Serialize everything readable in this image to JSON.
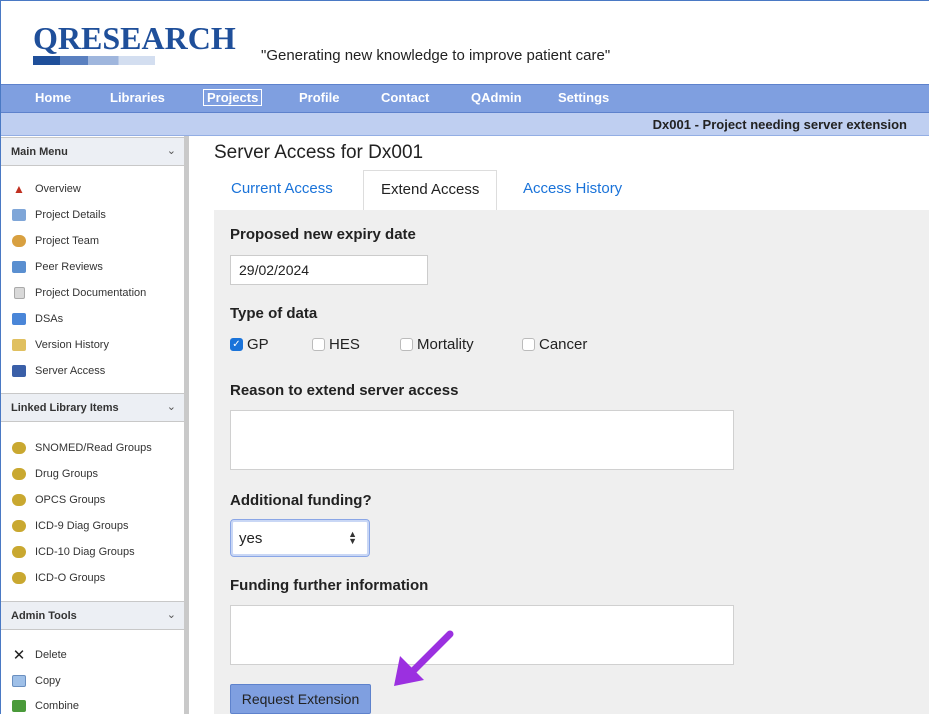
{
  "header": {
    "logo_text": "QRESEARCH",
    "tagline": "\"Generating new knowledge to improve patient care\""
  },
  "nav": {
    "items": [
      {
        "label": "Home",
        "active": false
      },
      {
        "label": "Libraries",
        "active": false
      },
      {
        "label": "Projects",
        "active": true
      },
      {
        "label": "Profile",
        "active": false
      },
      {
        "label": "Contact",
        "active": false
      },
      {
        "label": "QAdmin",
        "active": false
      },
      {
        "label": "Settings",
        "active": false
      }
    ]
  },
  "project": {
    "title": "Dx001 - Project needing server extension"
  },
  "sidebar": {
    "main_menu": {
      "heading": "Main Menu",
      "items": [
        {
          "label": "Overview",
          "icon": "overview-icon"
        },
        {
          "label": "Project Details",
          "icon": "project-details-icon"
        },
        {
          "label": "Project Team",
          "icon": "team-icon"
        },
        {
          "label": "Peer Reviews",
          "icon": "peer-review-icon"
        },
        {
          "label": "Project Documentation",
          "icon": "document-icon"
        },
        {
          "label": "DSAs",
          "icon": "dsa-icon"
        },
        {
          "label": "Version History",
          "icon": "version-history-icon"
        },
        {
          "label": "Server Access",
          "icon": "server-icon"
        }
      ]
    },
    "linked_library": {
      "heading": "Linked Library Items",
      "items": [
        {
          "label": "SNOMED/Read Groups",
          "icon": "library-group-icon"
        },
        {
          "label": "Drug Groups",
          "icon": "library-group-icon"
        },
        {
          "label": "OPCS Groups",
          "icon": "library-group-icon"
        },
        {
          "label": "ICD-9 Diag Groups",
          "icon": "library-group-icon"
        },
        {
          "label": "ICD-10 Diag Groups",
          "icon": "library-group-icon"
        },
        {
          "label": "ICD-O Groups",
          "icon": "library-group-icon"
        }
      ]
    },
    "admin_tools": {
      "heading": "Admin Tools",
      "items": [
        {
          "label": "Delete",
          "icon": "delete-x-icon"
        },
        {
          "label": "Copy",
          "icon": "copy-icon"
        },
        {
          "label": "Combine",
          "icon": "combine-icon"
        }
      ]
    }
  },
  "main": {
    "page_title": "Server Access for Dx001",
    "tabs": [
      {
        "label": "Current Access",
        "active": false
      },
      {
        "label": "Extend Access",
        "active": true
      },
      {
        "label": "Access History",
        "active": false
      }
    ],
    "form": {
      "expiry_label": "Proposed new expiry date",
      "expiry_value": "29/02/2024",
      "data_type_label": "Type of data",
      "data_types": [
        {
          "label": "GP",
          "checked": true
        },
        {
          "label": "HES",
          "checked": false
        },
        {
          "label": "Mortality",
          "checked": false
        },
        {
          "label": "Cancer",
          "checked": false
        }
      ],
      "reason_label": "Reason to extend server access",
      "reason_value": "",
      "funding_label": "Additional funding?",
      "funding_value": "yes",
      "funding_info_label": "Funding further information",
      "funding_info_value": "",
      "submit_label": "Request Extension"
    }
  },
  "colors": {
    "nav_bg": "#7f9fe0",
    "subbar_bg": "#bfcff1",
    "link_blue": "#1a73d9",
    "logo_blue": "#1f4f9a",
    "annotation_arrow": "#9b30e0"
  }
}
